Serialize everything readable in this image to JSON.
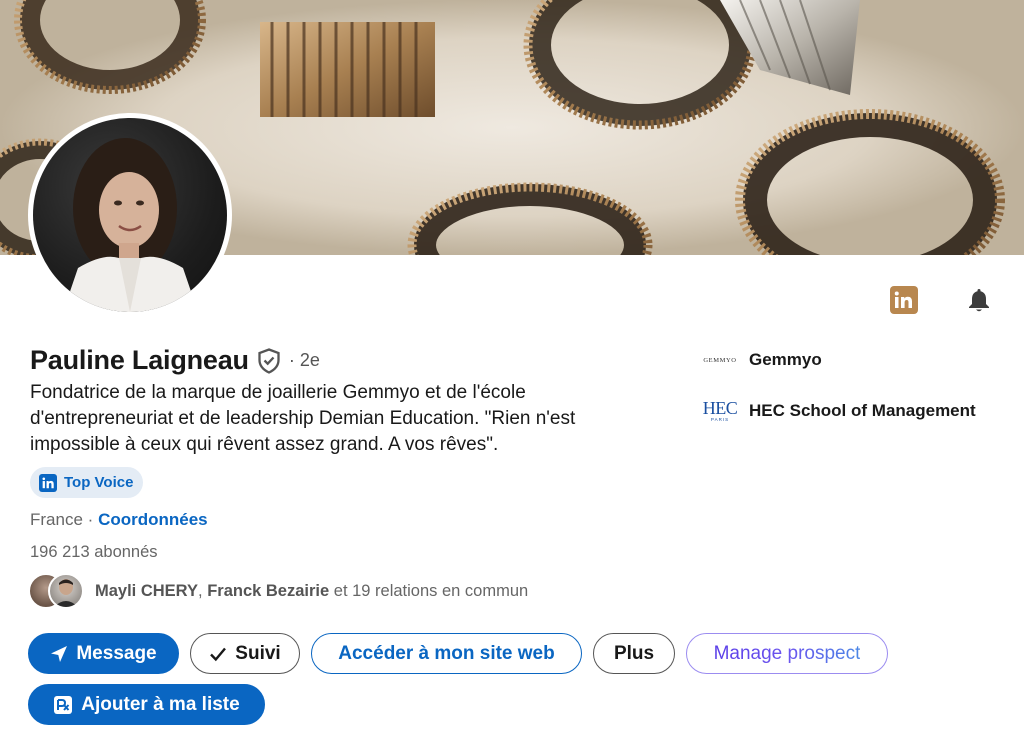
{
  "profile": {
    "name": "Pauline Laigneau",
    "degree": "· 2e",
    "headline": "Fondatrice de la marque de joaillerie Gemmyo et de l'école d'entrepreneuriat et de leadership Demian Education. \"Rien n'est impossible à ceux qui rêvent assez grand. A vos rêves\".",
    "badge_label": "Top Voice",
    "location": "France",
    "location_sep": "·",
    "contact_link": "Coordonnées",
    "followers": "196 213 abonnés"
  },
  "mutual": {
    "name1": "Mayli CHERY",
    "separator": ",",
    "name2": "Franck Bezairie",
    "rest": "et 19 relations en commun"
  },
  "actions": {
    "message": "Message",
    "follow": "Suivi",
    "website": "Accéder à mon site web",
    "more": "Plus",
    "manage": "Manage prospect",
    "add_list": "Ajouter à ma liste"
  },
  "companies": [
    {
      "name": "Gemmyo",
      "logo_text": "GEMMYO"
    },
    {
      "name": "HEC School of Management",
      "logo_text": "HEC",
      "logo_sub": "PARIS"
    }
  ],
  "icons": {
    "linkedin": "linkedin-icon",
    "bell": "bell-icon",
    "verified": "shield-check-icon",
    "send": "send-icon",
    "check": "check-icon",
    "list": "add-list-icon"
  },
  "colors": {
    "primary": "#0a66c2",
    "badge_bg": "#e4ecf5",
    "linkedin_gold": "#b8874f",
    "manage_border": "#9b8cf0"
  }
}
